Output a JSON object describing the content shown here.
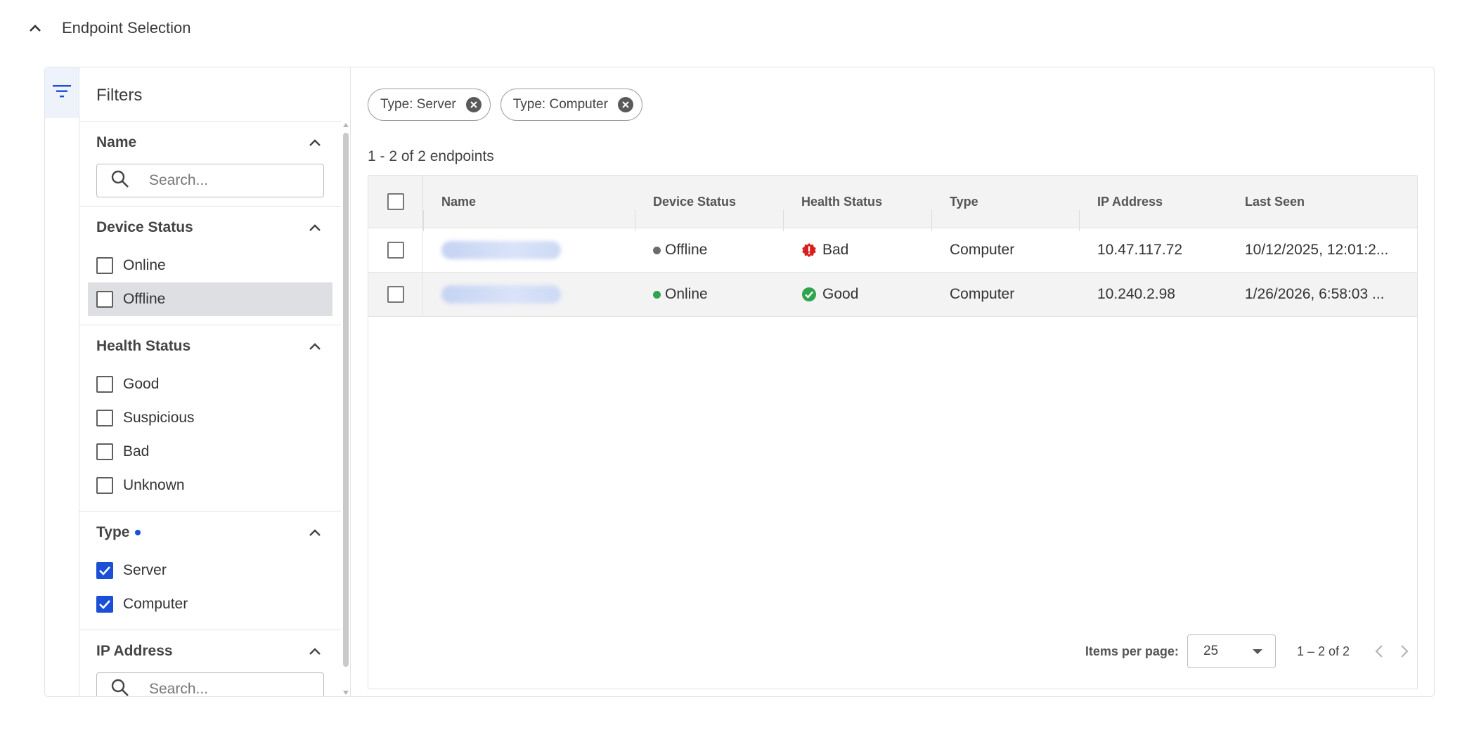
{
  "section": {
    "title": "Endpoint Selection"
  },
  "filters": {
    "title": "Filters",
    "name_group": {
      "title": "Name",
      "placeholder": "Search..."
    },
    "device_status": {
      "title": "Device Status",
      "options": [
        {
          "label": "Online",
          "checked": false
        },
        {
          "label": "Offline",
          "checked": false
        }
      ]
    },
    "health_status": {
      "title": "Health Status",
      "options": [
        {
          "label": "Good",
          "checked": false
        },
        {
          "label": "Suspicious",
          "checked": false
        },
        {
          "label": "Bad",
          "checked": false
        },
        {
          "label": "Unknown",
          "checked": false
        }
      ]
    },
    "type": {
      "title": "Type",
      "options": [
        {
          "label": "Server",
          "checked": true
        },
        {
          "label": "Computer",
          "checked": true
        }
      ]
    },
    "ip_group": {
      "title": "IP Address",
      "placeholder": "Search..."
    }
  },
  "chips": [
    {
      "label": "Type: Server"
    },
    {
      "label": "Type: Computer"
    }
  ],
  "count_text": "1 - 2 of 2 endpoints",
  "table": {
    "headers": {
      "name": "Name",
      "device_status": "Device Status",
      "health_status": "Health Status",
      "type": "Type",
      "ip": "IP Address",
      "last_seen": "Last Seen"
    },
    "rows": [
      {
        "device_status": "Offline",
        "health_status": "Bad",
        "type": "Computer",
        "ip": "10.47.117.72",
        "last_seen": "10/12/2025, 12:01:2..."
      },
      {
        "device_status": "Online",
        "health_status": "Good",
        "type": "Computer",
        "ip": "10.240.2.98",
        "last_seen": "1/26/2026, 6:58:03 ..."
      }
    ]
  },
  "pagination": {
    "items_per_page_label": "Items per page:",
    "items_per_page_value": "25",
    "range": "1 – 2 of 2"
  },
  "colors": {
    "accent": "#1a4fd6",
    "offline_dot": "#6b6b6b",
    "online_dot": "#2ea44f",
    "bad": "#d81e1e",
    "good": "#2ea44f"
  }
}
